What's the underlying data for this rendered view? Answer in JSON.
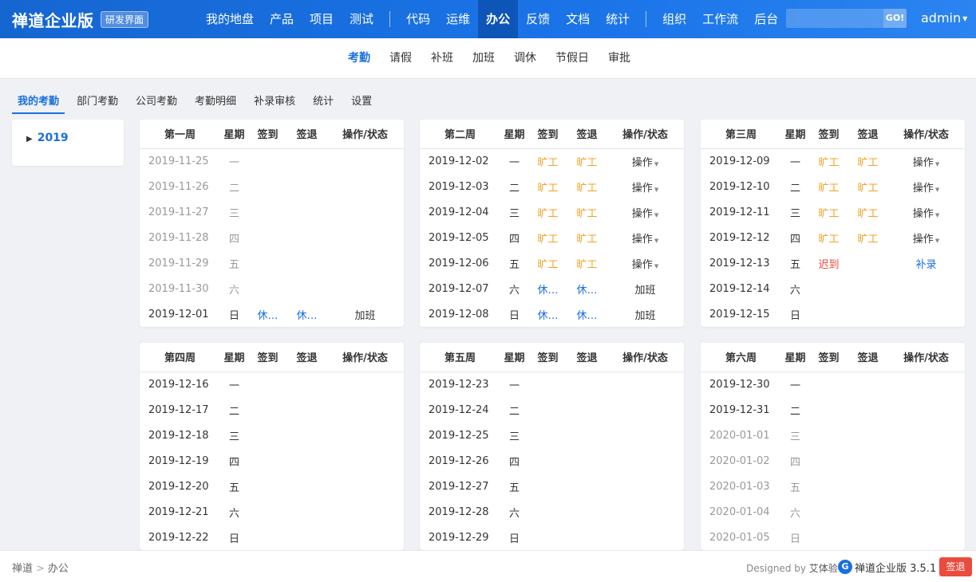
{
  "app": {
    "brand": "禅道企业版",
    "badge": "研发界面"
  },
  "topnav": {
    "group1": [
      "我的地盘",
      "产品",
      "项目",
      "测试"
    ],
    "group2": [
      "代码",
      "运维",
      "办公",
      "反馈",
      "文档",
      "统计"
    ],
    "group3": [
      "组织",
      "工作流",
      "后台"
    ],
    "active": "办公",
    "search_button": "GO!",
    "user": "admin"
  },
  "subnav": {
    "items": [
      "考勤",
      "请假",
      "补班",
      "加班",
      "调休",
      "节假日",
      "审批"
    ],
    "active": "考勤"
  },
  "tabs": {
    "items": [
      "我的考勤",
      "部门考勤",
      "公司考勤",
      "考勤明细",
      "补录审核",
      "统计",
      "设置"
    ],
    "active": "我的考勤"
  },
  "sidebar": {
    "year": "2019"
  },
  "columns": {
    "weekday": "星期",
    "sign_in": "签到",
    "sign_out": "签退",
    "action": "操作/状态"
  },
  "action_label": "操作",
  "weeks": [
    {
      "title": "第一周",
      "days": [
        {
          "date": "2019-11-25",
          "wd": "一",
          "muted": true,
          "in": "",
          "out": "",
          "action": ""
        },
        {
          "date": "2019-11-26",
          "wd": "二",
          "muted": true,
          "in": "",
          "out": "",
          "action": ""
        },
        {
          "date": "2019-11-27",
          "wd": "三",
          "muted": true,
          "in": "",
          "out": "",
          "action": ""
        },
        {
          "date": "2019-11-28",
          "wd": "四",
          "muted": true,
          "in": "",
          "out": "",
          "action": ""
        },
        {
          "date": "2019-11-29",
          "wd": "五",
          "muted": true,
          "in": "",
          "out": "",
          "action": ""
        },
        {
          "date": "2019-11-30",
          "wd": "六",
          "muted": true,
          "in": "",
          "out": "",
          "action": ""
        },
        {
          "date": "2019-12-01",
          "wd": "日",
          "muted": false,
          "in": "休…",
          "in_type": "rest",
          "out": "休…",
          "out_type": "rest",
          "action": "加班",
          "action_type": "text"
        }
      ]
    },
    {
      "title": "第二周",
      "days": [
        {
          "date": "2019-12-02",
          "wd": "一",
          "in": "旷工",
          "in_type": "absent",
          "out": "旷工",
          "out_type": "absent",
          "action": "操作",
          "action_type": "dropdown"
        },
        {
          "date": "2019-12-03",
          "wd": "二",
          "in": "旷工",
          "in_type": "absent",
          "out": "旷工",
          "out_type": "absent",
          "action": "操作",
          "action_type": "dropdown"
        },
        {
          "date": "2019-12-04",
          "wd": "三",
          "in": "旷工",
          "in_type": "absent",
          "out": "旷工",
          "out_type": "absent",
          "action": "操作",
          "action_type": "dropdown"
        },
        {
          "date": "2019-12-05",
          "wd": "四",
          "in": "旷工",
          "in_type": "absent",
          "out": "旷工",
          "out_type": "absent",
          "action": "操作",
          "action_type": "dropdown"
        },
        {
          "date": "2019-12-06",
          "wd": "五",
          "in": "旷工",
          "in_type": "absent",
          "out": "旷工",
          "out_type": "absent",
          "action": "操作",
          "action_type": "dropdown"
        },
        {
          "date": "2019-12-07",
          "wd": "六",
          "in": "休…",
          "in_type": "rest",
          "out": "休…",
          "out_type": "rest",
          "action": "加班",
          "action_type": "text"
        },
        {
          "date": "2019-12-08",
          "wd": "日",
          "in": "休…",
          "in_type": "rest",
          "out": "休…",
          "out_type": "rest",
          "action": "加班",
          "action_type": "text"
        }
      ]
    },
    {
      "title": "第三周",
      "days": [
        {
          "date": "2019-12-09",
          "wd": "一",
          "in": "旷工",
          "in_type": "absent",
          "out": "旷工",
          "out_type": "absent",
          "action": "操作",
          "action_type": "dropdown"
        },
        {
          "date": "2019-12-10",
          "wd": "二",
          "in": "旷工",
          "in_type": "absent",
          "out": "旷工",
          "out_type": "absent",
          "action": "操作",
          "action_type": "dropdown"
        },
        {
          "date": "2019-12-11",
          "wd": "三",
          "in": "旷工",
          "in_type": "absent",
          "out": "旷工",
          "out_type": "absent",
          "action": "操作",
          "action_type": "dropdown"
        },
        {
          "date": "2019-12-12",
          "wd": "四",
          "in": "旷工",
          "in_type": "absent",
          "out": "旷工",
          "out_type": "absent",
          "action": "操作",
          "action_type": "dropdown"
        },
        {
          "date": "2019-12-13",
          "wd": "五",
          "in": "迟到",
          "in_type": "late",
          "out": "",
          "action": "补录",
          "action_type": "link"
        },
        {
          "date": "2019-12-14",
          "wd": "六",
          "in": "",
          "out": "",
          "action": ""
        },
        {
          "date": "2019-12-15",
          "wd": "日",
          "in": "",
          "out": "",
          "action": ""
        }
      ]
    },
    {
      "title": "第四周",
      "days": [
        {
          "date": "2019-12-16",
          "wd": "一",
          "in": "",
          "out": "",
          "action": ""
        },
        {
          "date": "2019-12-17",
          "wd": "二",
          "in": "",
          "out": "",
          "action": ""
        },
        {
          "date": "2019-12-18",
          "wd": "三",
          "in": "",
          "out": "",
          "action": ""
        },
        {
          "date": "2019-12-19",
          "wd": "四",
          "in": "",
          "out": "",
          "action": ""
        },
        {
          "date": "2019-12-20",
          "wd": "五",
          "in": "",
          "out": "",
          "action": ""
        },
        {
          "date": "2019-12-21",
          "wd": "六",
          "in": "",
          "out": "",
          "action": ""
        },
        {
          "date": "2019-12-22",
          "wd": "日",
          "in": "",
          "out": "",
          "action": ""
        }
      ]
    },
    {
      "title": "第五周",
      "days": [
        {
          "date": "2019-12-23",
          "wd": "一",
          "in": "",
          "out": "",
          "action": ""
        },
        {
          "date": "2019-12-24",
          "wd": "二",
          "in": "",
          "out": "",
          "action": ""
        },
        {
          "date": "2019-12-25",
          "wd": "三",
          "in": "",
          "out": "",
          "action": ""
        },
        {
          "date": "2019-12-26",
          "wd": "四",
          "in": "",
          "out": "",
          "action": ""
        },
        {
          "date": "2019-12-27",
          "wd": "五",
          "in": "",
          "out": "",
          "action": ""
        },
        {
          "date": "2019-12-28",
          "wd": "六",
          "in": "",
          "out": "",
          "action": ""
        },
        {
          "date": "2019-12-29",
          "wd": "日",
          "in": "",
          "out": "",
          "action": ""
        }
      ]
    },
    {
      "title": "第六周",
      "days": [
        {
          "date": "2019-12-30",
          "wd": "一",
          "in": "",
          "out": "",
          "action": ""
        },
        {
          "date": "2019-12-31",
          "wd": "二",
          "in": "",
          "out": "",
          "action": ""
        },
        {
          "date": "2020-01-01",
          "wd": "三",
          "muted": true,
          "in": "",
          "out": "",
          "action": ""
        },
        {
          "date": "2020-01-02",
          "wd": "四",
          "muted": true,
          "in": "",
          "out": "",
          "action": ""
        },
        {
          "date": "2020-01-03",
          "wd": "五",
          "muted": true,
          "in": "",
          "out": "",
          "action": ""
        },
        {
          "date": "2020-01-04",
          "wd": "六",
          "muted": true,
          "in": "",
          "out": "",
          "action": ""
        },
        {
          "date": "2020-01-05",
          "wd": "日",
          "muted": true,
          "in": "",
          "out": "",
          "action": ""
        }
      ]
    }
  ],
  "footer": {
    "breadcrumb": [
      "禅道",
      "办公"
    ],
    "breadcrumb_sep": ">",
    "designed_prefix": "Designed by",
    "designer": "艾体验",
    "logo_glyph": "G",
    "product": "禅道企业版 3.5.1",
    "signout": "签退"
  },
  "colors": {
    "primary": "#1a6fe0",
    "absent": "#f1a325",
    "late": "#ea4b3d",
    "signout_bg": "#ea4b3d"
  }
}
